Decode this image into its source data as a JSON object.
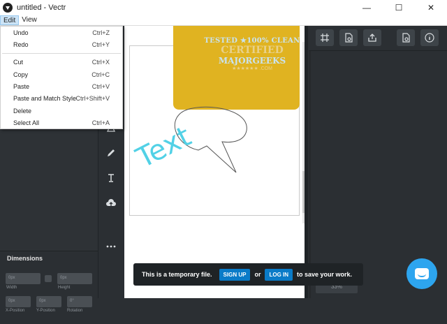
{
  "window": {
    "title": "untitled - Vectr",
    "minimize_glyph": "—",
    "maximize_glyph": "☐",
    "close_glyph": "✕"
  },
  "menubar": {
    "items": [
      {
        "label": "Edit"
      },
      {
        "label": "View"
      }
    ]
  },
  "edit_menu": {
    "items": [
      {
        "label": "Undo",
        "accel": "Ctrl+Z"
      },
      {
        "label": "Redo",
        "accel": "Ctrl+Y"
      },
      {
        "label": "Cut",
        "accel": "Ctrl+X"
      },
      {
        "label": "Copy",
        "accel": "Ctrl+C"
      },
      {
        "label": "Paste",
        "accel": "Ctrl+V"
      },
      {
        "label": "Paste and Match Style",
        "accel": "Ctrl+Shift+V"
      },
      {
        "label": "Delete",
        "accel": ""
      },
      {
        "label": "Select All",
        "accel": "Ctrl+A"
      }
    ]
  },
  "dimensions": {
    "title": "Dimensions",
    "width_label": "Width",
    "height_label": "Height",
    "xpos_label": "X-Position",
    "ypos_label": "Y-Position",
    "rotation_label": "Rotation",
    "width_value": "0px",
    "height_value": "0px",
    "xpos_value": "0px",
    "ypos_value": "0px",
    "rotation_value": "0°"
  },
  "canvas": {
    "text_object": "Text",
    "accent_shape_color": "#e0b321",
    "text_color": "#52d1e6"
  },
  "watermark": {
    "line1": "TESTED ★100% CLEAN",
    "line2": "CERTIFIED",
    "line3": "MAJORGEEKS",
    "line4": "★★★★★★ .COM"
  },
  "right_panel": {
    "zoom_value": "33%"
  },
  "toast": {
    "message": "This is a temporary file.",
    "signup_label": "SIGN UP",
    "or_label": "or",
    "login_label": "LOG IN",
    "tail": "to save your work."
  }
}
